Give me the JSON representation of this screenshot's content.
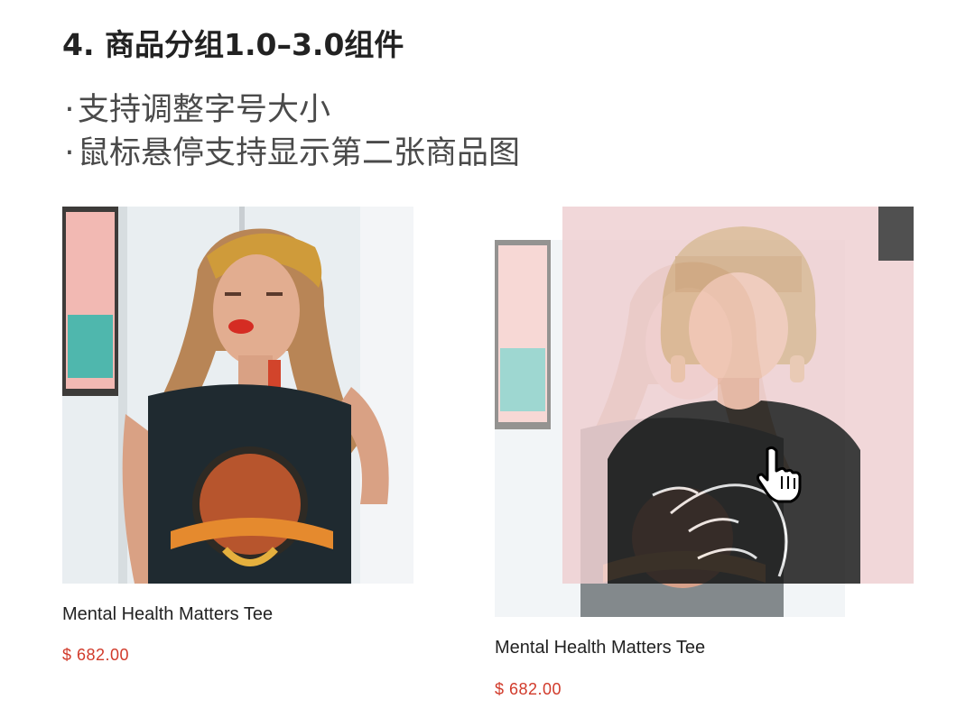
{
  "section": {
    "title": "4. 商品分组1.0–3.0组件"
  },
  "features": [
    {
      "label": "支持调整字号大小"
    },
    {
      "label": "鼠标悬停支持显示第二张商品图"
    }
  ],
  "bullet_glyph": "·",
  "products": [
    {
      "title": "Mental Health Matters Tee",
      "price": "$ 682.00",
      "image_icon": "model-surrender-tee-photo"
    },
    {
      "title": "Mental Health Matters Tee",
      "price": "$ 682.00",
      "image_icon": "model-mental-health-tee-photo",
      "state": "hover",
      "hover_image_icon": "second-product-photo"
    }
  ],
  "colors": {
    "title": "#222222",
    "feature_text": "#4a4a4a",
    "price": "#d13a2a",
    "background": "#ffffff"
  },
  "cursor_icon": "hand-pointer-icon"
}
